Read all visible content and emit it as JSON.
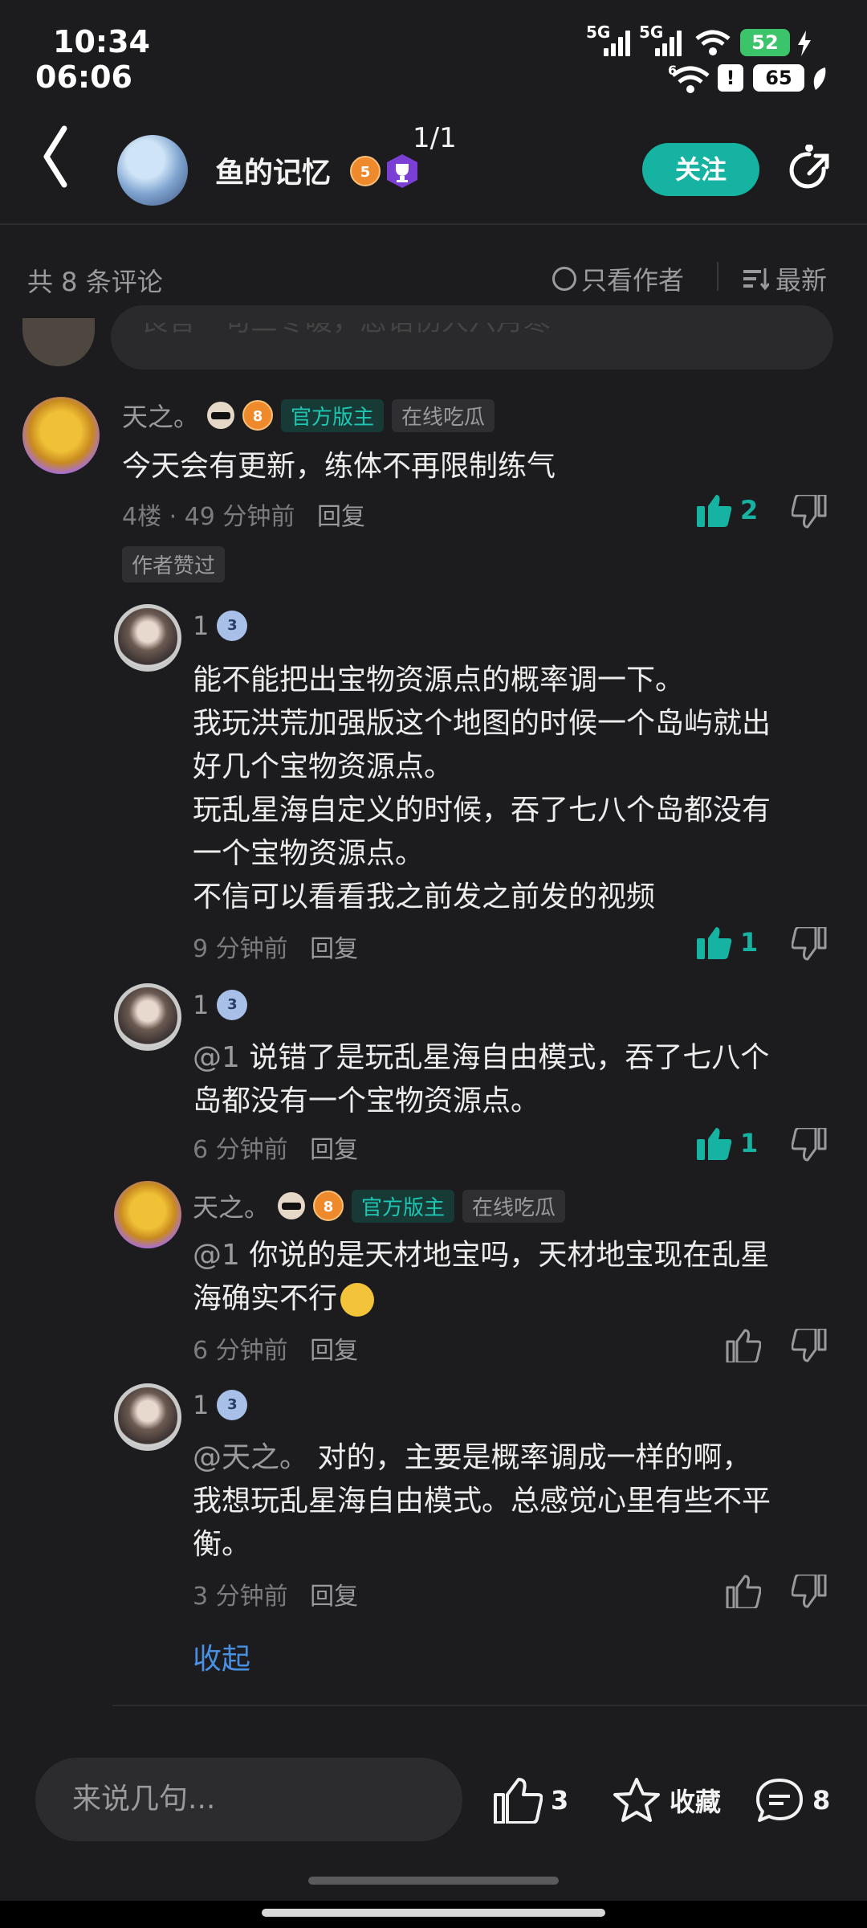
{
  "status_bar": {
    "time_top": "10:34",
    "time_bottom": "06:06",
    "battery_top": "52",
    "battery_bottom": "65",
    "network_1": "5G",
    "network_2": "5G",
    "network_3": "6"
  },
  "header": {
    "author_name": "鱼的记忆",
    "author_level": "5",
    "page_counter": "1/1",
    "follow_label": "关注"
  },
  "filter": {
    "total": "共 8 条评论",
    "only_author": "只看作者",
    "sort": "最新"
  },
  "prev_comment_text": "良言一句三冬暖，恶语伤人六月寒",
  "comments": [
    {
      "name": "天之。",
      "level": "8",
      "tag_mod": "官方版主",
      "tag_status": "在线吃瓜",
      "text": "今天会有更新，练体不再限制练气",
      "floor": "4楼",
      "time": "49 分钟前",
      "reply": "回复",
      "likes": "2",
      "author_liked": "作者赞过"
    },
    {
      "name": "1",
      "level": "3",
      "lines": [
        "能不能把出宝物资源点的概率调一下。",
        "我玩洪荒加强版这个地图的时候一个岛屿就出",
        "好几个宝物资源点。",
        "玩乱星海自定义的时候，吞了七八个岛都没有",
        "一个宝物资源点。",
        "不信可以看看我之前发之前发的视频"
      ],
      "time": "9 分钟前",
      "reply": "回复",
      "likes": "1"
    },
    {
      "name": "1",
      "level": "3",
      "mention": "@1",
      "lines": [
        "说错了是玩乱星海自由模式，吞了七八个",
        "岛都没有一个宝物资源点。"
      ],
      "time": "6 分钟前",
      "reply": "回复",
      "likes": "1"
    },
    {
      "name": "天之。",
      "level": "8",
      "tag_mod": "官方版主",
      "tag_status": "在线吃瓜",
      "mention": "@1",
      "lines": [
        "你说的是天材地宝吗，天材地宝现在乱星",
        "海确实不行"
      ],
      "time": "6 分钟前",
      "reply": "回复"
    },
    {
      "name": "1",
      "level": "3",
      "mention": "@天之。",
      "lines": [
        "对的，主要是概率调成一样的啊，",
        "我想玩乱星海自由模式。总感觉心里有些不平",
        "衡。"
      ],
      "time": "3 分钟前",
      "reply": "回复"
    }
  ],
  "collapse_label": "收起",
  "bottom_bar": {
    "input_placeholder": "来说几句...",
    "likes": "3",
    "favorite_label": "收藏",
    "comment_count": "8"
  },
  "colors": {
    "accent": "#16b3a3",
    "background": "#1c1c1e",
    "link": "#4a90e2"
  }
}
